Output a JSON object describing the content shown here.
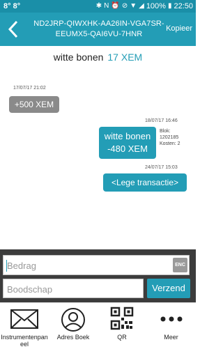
{
  "status": {
    "left": "8° 8°",
    "battery": "100%",
    "time": "22:50"
  },
  "header": {
    "address": "ND2JRP-QIWXHK-AA26IN-VGA7SR-EEUMX5-QAI6VU-7HNR",
    "copy_label": "Kopieer"
  },
  "contact": {
    "name": "witte bonen",
    "balance": "17 XEM"
  },
  "messages": [
    {
      "timestamp": "17/07/17 21:02",
      "text": "+500 XEM"
    },
    {
      "timestamp": "18/07/17 16:46",
      "text_line1": "witte bonen",
      "text_line2": "-480 XEM",
      "block_label": "Blok:",
      "block": "1202185",
      "fee": "Kosten: 2"
    },
    {
      "timestamp": "24/07/17 15:03",
      "text": "<Lege transactie>"
    }
  ],
  "composer": {
    "amount_placeholder": "Bedrag",
    "enc_label": "ENC",
    "message_placeholder": "Boodschap",
    "send_label": "Verzend"
  },
  "nav": [
    {
      "label": "Instrumentenpaneel",
      "icon": "envelope-icon"
    },
    {
      "label": "Adres Boek",
      "icon": "person-icon"
    },
    {
      "label": "QR",
      "icon": "qr-icon"
    },
    {
      "label": "Meer",
      "icon": "more-dots-icon"
    }
  ],
  "colors": {
    "primary": "#239db6",
    "statusbar": "#1a8fa8",
    "received_bubble": "#8a8a8a",
    "composer_bg": "#3c3c3c"
  }
}
